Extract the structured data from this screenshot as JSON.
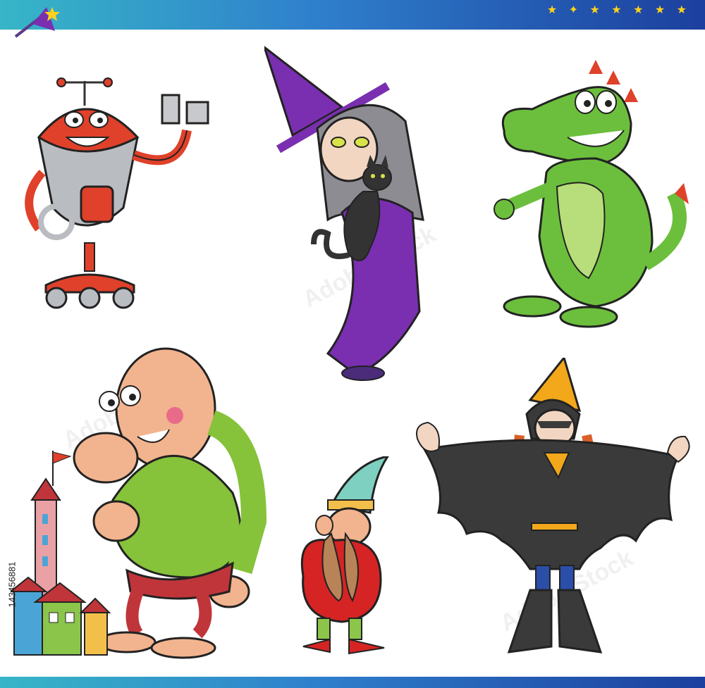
{
  "stock_id": "143456881",
  "watermark_text": "Adobe Stock",
  "colors": {
    "banner_start": "#37b6c7",
    "banner_end": "#1c3f9e",
    "star": "#ffd21a",
    "robot_red": "#e0412a",
    "robot_grey": "#b9bcc0",
    "witch_purple": "#7a2fb0",
    "dragon_green": "#6cbf3c",
    "giant_shirt": "#86c23a",
    "dwarf_red": "#d62424",
    "bat_cape": "#3a3a3a"
  },
  "characters": [
    {
      "name": "robot"
    },
    {
      "name": "witch with cat"
    },
    {
      "name": "dragon"
    },
    {
      "name": "giant"
    },
    {
      "name": "dwarf"
    },
    {
      "name": "bat costume kid"
    }
  ],
  "decorations": [
    "stars-icon",
    "wizard-hat-wand-icon",
    "castle-icon",
    "houses-icon"
  ]
}
